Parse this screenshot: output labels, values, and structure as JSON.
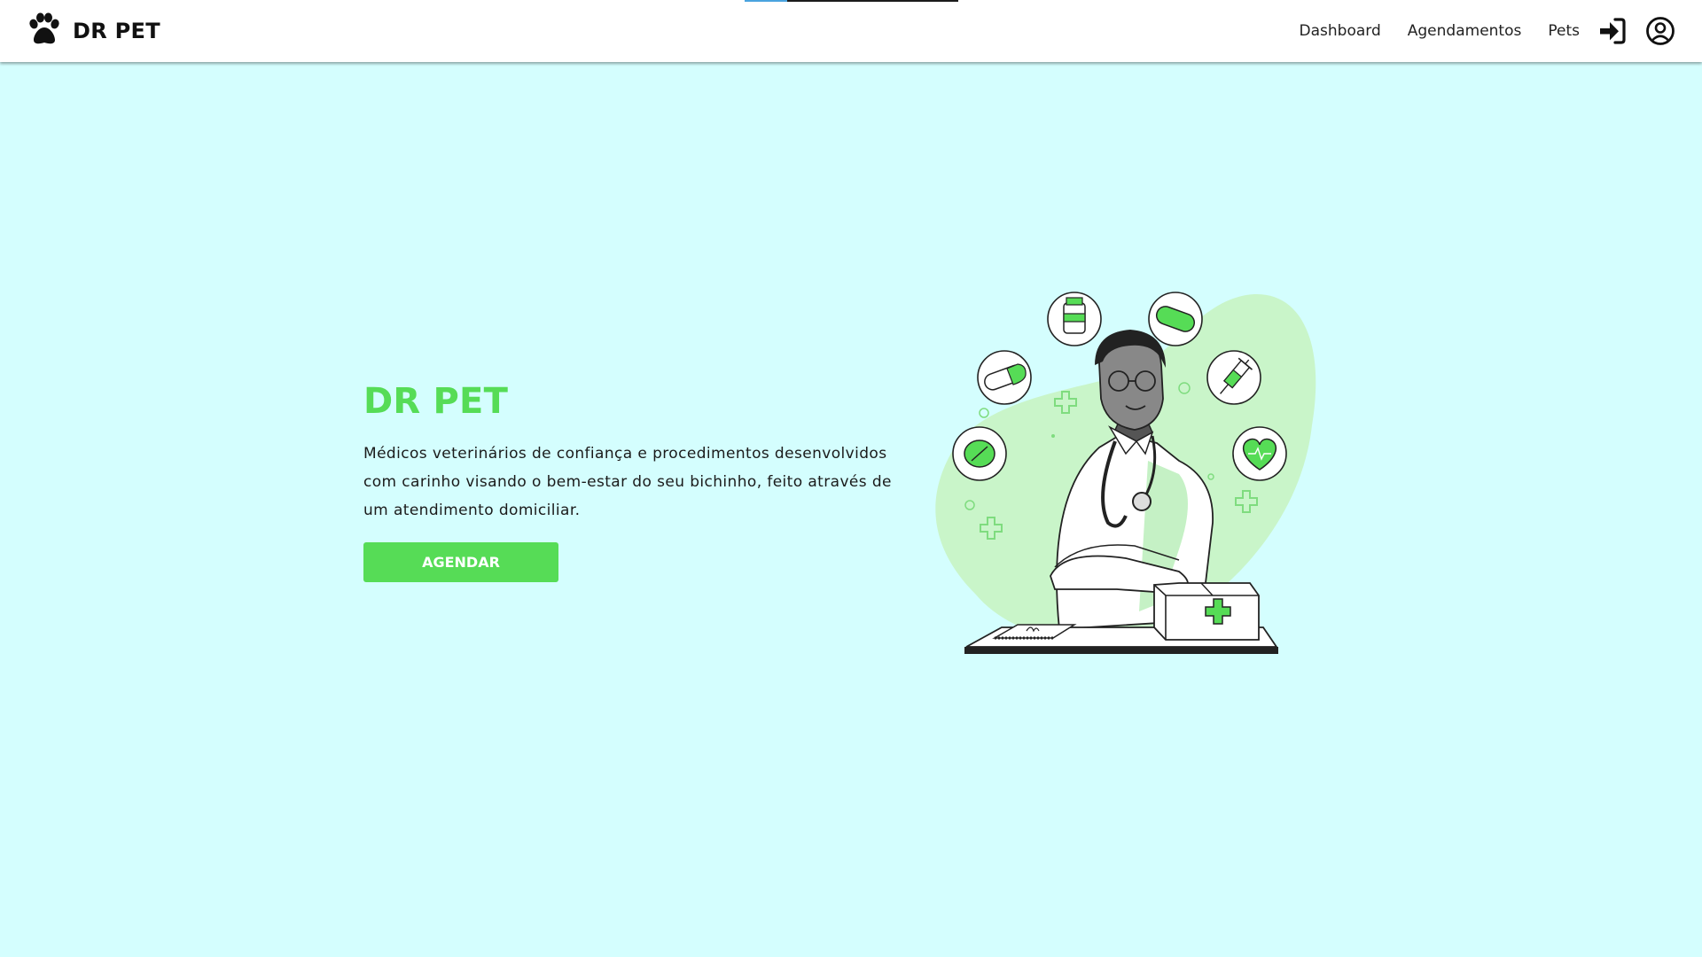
{
  "nav": {
    "brand": "DR PET",
    "links": [
      "Dashboard",
      "Agendamentos",
      "Pets"
    ],
    "icons": [
      "paw-icon",
      "login-icon",
      "user-circle-icon"
    ]
  },
  "hero": {
    "title": "DR PET",
    "description": "Médicos veterinários de confiança e procedimentos desenvolvidos com carinho visando o bem-estar do seu bichinho, feito através de um atendimento domiciliar.",
    "cta_label": "AGENDAR",
    "illustration": "veterinarian-illustration"
  },
  "colors": {
    "background": "#d4fefe",
    "accent": "#56dc56",
    "navbar": "#ffffff"
  },
  "loading_progress": 0.2
}
